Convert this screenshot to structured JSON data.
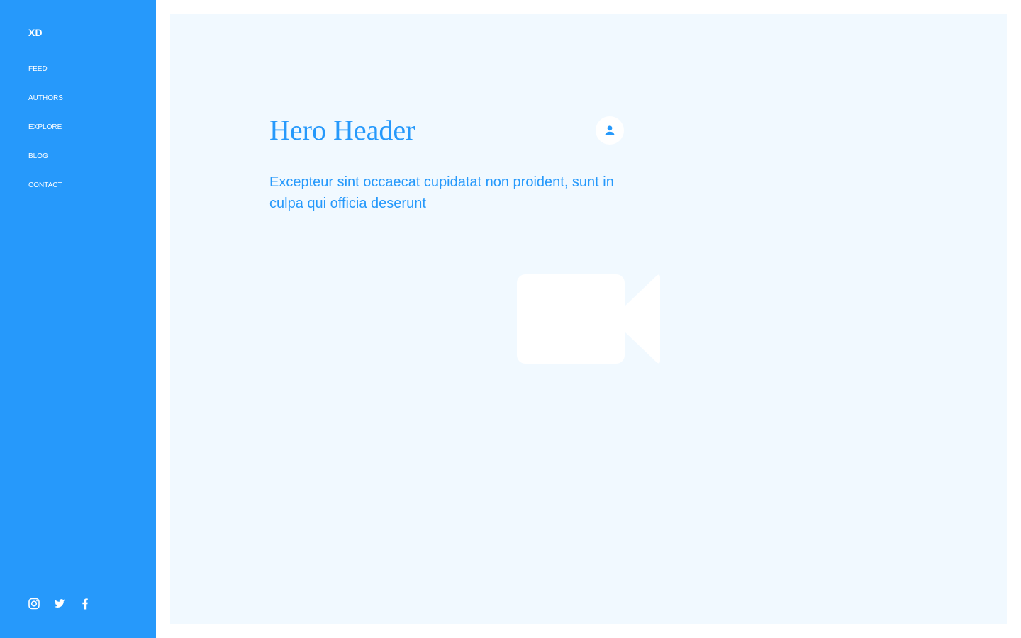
{
  "brand": {
    "logo": "XD"
  },
  "nav": {
    "items": [
      {
        "label": "FEED"
      },
      {
        "label": "AUTHORS"
      },
      {
        "label": "EXPLORE"
      },
      {
        "label": "BLOG"
      },
      {
        "label": "CONTACT"
      }
    ]
  },
  "social": {
    "icons": [
      "instagram-icon",
      "twitter-icon",
      "facebook-icon"
    ]
  },
  "hero": {
    "title": "Hero Header",
    "text": "Excepteur sint occaecat cupidatat non proident, sunt in culpa qui officia deserunt",
    "avatar_icon": "user-icon",
    "media_icon": "video-camera-icon"
  },
  "colors": {
    "accent": "#2699fb",
    "panel": "#f1f9ff",
    "white": "#ffffff"
  }
}
